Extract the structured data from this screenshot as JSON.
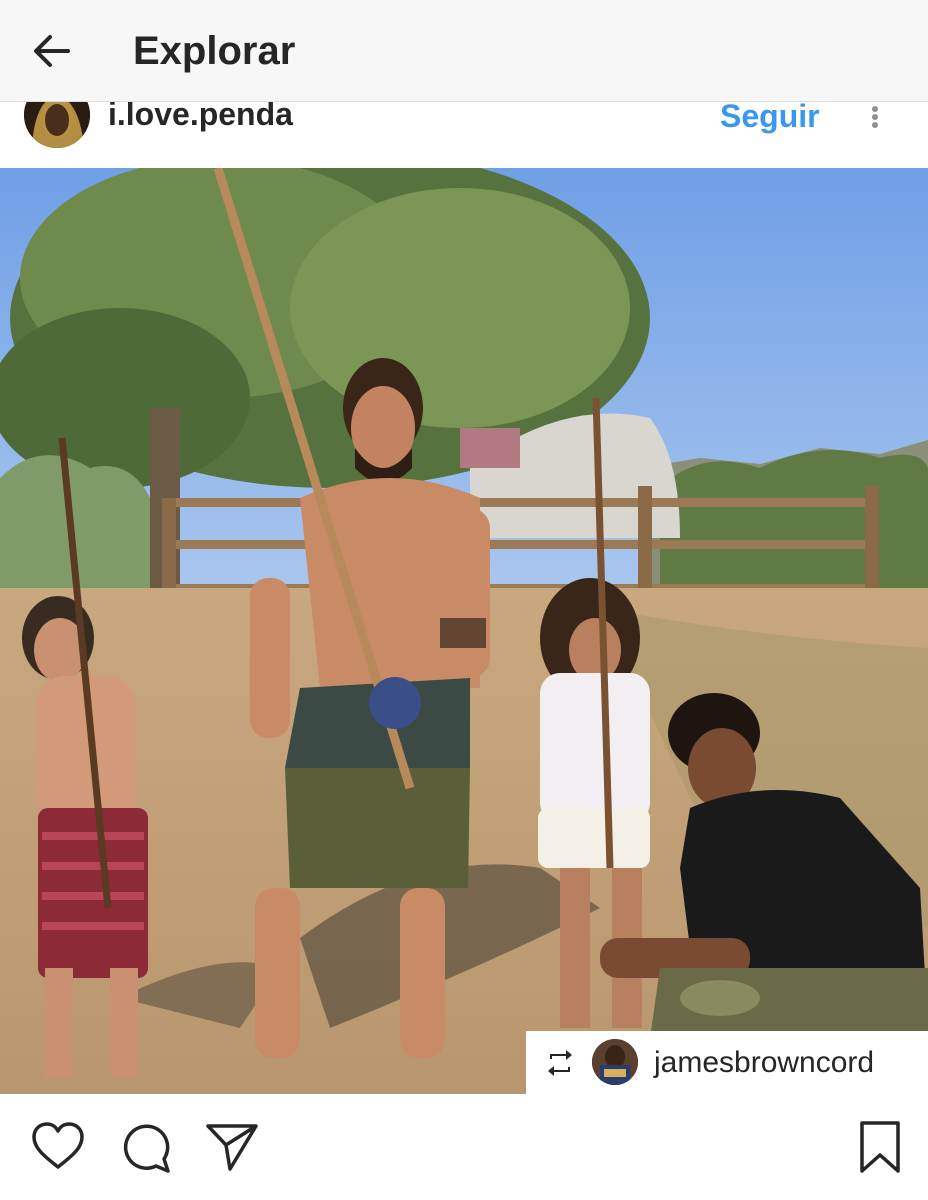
{
  "appbar": {
    "title": "Explorar",
    "back_icon": "arrow-left-icon"
  },
  "post": {
    "username": "i.love.penda",
    "follow_label": "Seguir",
    "more_icon": "more-vertical-icon"
  },
  "repost": {
    "icon": "repost-icon",
    "username": "jamesbrowncord"
  },
  "actions": {
    "like_icon": "heart-icon",
    "comment_icon": "comment-icon",
    "share_icon": "send-icon",
    "save_icon": "bookmark-icon"
  },
  "colors": {
    "link_blue": "#3897f0",
    "text_dark": "#262626",
    "appbar_bg": "#f7f7f7"
  }
}
